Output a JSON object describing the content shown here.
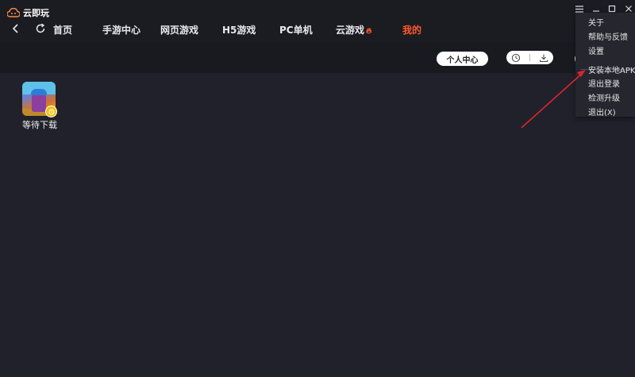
{
  "app": {
    "title": "云即玩"
  },
  "nav": {
    "tabs": [
      {
        "label": "首页"
      },
      {
        "label": "手游中心"
      },
      {
        "label": "网页游戏"
      },
      {
        "label": "H5游戏"
      },
      {
        "label": "PC单机"
      },
      {
        "label": "云游戏"
      },
      {
        "label": "我的"
      }
    ],
    "active_tab": "我的",
    "fire_icon": "fire-icon"
  },
  "subbar": {
    "personal_center_label": "个人中心",
    "tools": [
      "history-icon",
      "download-icon"
    ]
  },
  "downloads": [
    {
      "label": "等待下载",
      "icon": "game-thumbnail"
    }
  ],
  "menu": {
    "items": [
      {
        "label": "关于"
      },
      {
        "label": "帮助与反馈"
      },
      {
        "label": "设置"
      },
      {
        "label": "安装本地APK"
      },
      {
        "label": "退出登录"
      },
      {
        "label": "检测升级"
      },
      {
        "label": "退出(X)"
      }
    ]
  },
  "colors": {
    "accent": "#ff5a2a",
    "background": "#21212b",
    "arrow": "#d9262c"
  }
}
